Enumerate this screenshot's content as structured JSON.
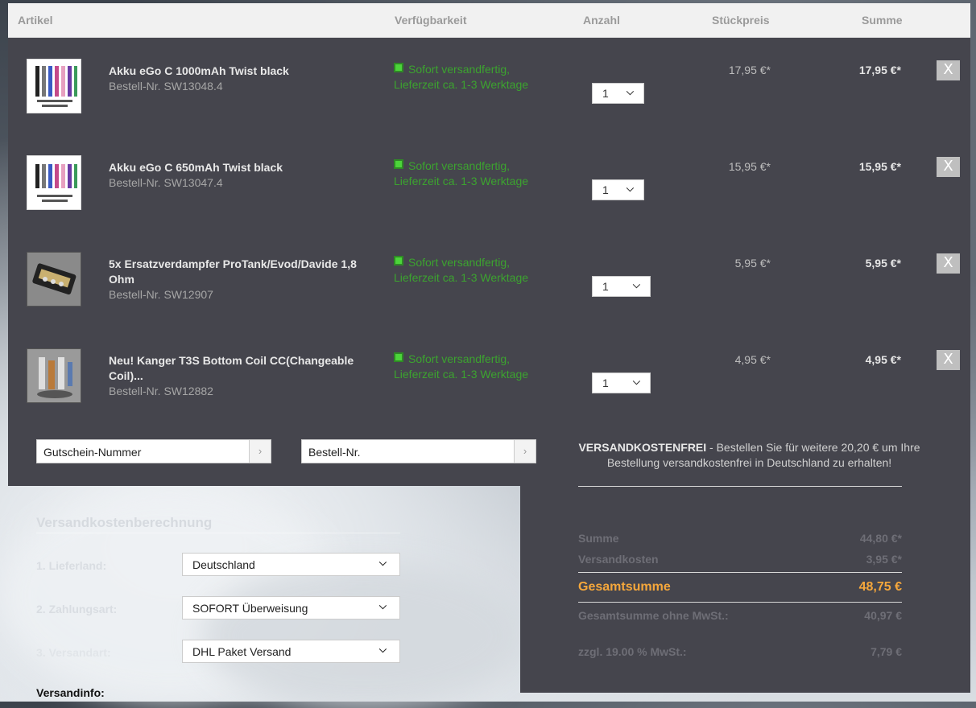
{
  "header": {
    "col_article": "Artikel",
    "col_availability": "Verfügbarkeit",
    "col_quantity": "Anzahl",
    "col_unit_price": "Stückpreis",
    "col_total": "Summe"
  },
  "items": [
    {
      "name": "Akku eGo C 1000mAh Twist black",
      "order_no": "Bestell-Nr. SW13048.4",
      "availability_line1": "Sofort versandfertig,",
      "availability_line2": "Lieferzeit ca. 1-3 Werktage",
      "quantity": "1",
      "unit_price": "17,95 €*",
      "total": "17,95 €*",
      "remove": "X"
    },
    {
      "name": "Akku eGo C 650mAh Twist black",
      "order_no": "Bestell-Nr. SW13047.4",
      "availability_line1": "Sofort versandfertig,",
      "availability_line2": "Lieferzeit ca. 1-3 Werktage",
      "quantity": "1",
      "unit_price": "15,95 €*",
      "total": "15,95 €*",
      "remove": "X"
    },
    {
      "name": "5x Ersatzverdampfer ProTank/Evod/Davide 1,8 Ohm",
      "order_no": "Bestell-Nr. SW12907",
      "availability_line1": "Sofort versandfertig,",
      "availability_line2": "Lieferzeit ca. 1-3 Werktage",
      "quantity": "1",
      "unit_price": "5,95 €*",
      "total": "5,95 €*",
      "remove": "X"
    },
    {
      "name": "Neu! Kanger T3S Bottom Coil CC(Changeable Coil)...",
      "order_no": "Bestell-Nr. SW12882",
      "availability_line1": "Sofort versandfertig,",
      "availability_line2": "Lieferzeit ca. 1-3 Werktage",
      "quantity": "1",
      "unit_price": "4,95 €*",
      "total": "4,95 €*",
      "remove": "X"
    }
  ],
  "voucher": {
    "value": "Gutschein-Nummer",
    "button": "›"
  },
  "order_number_input": {
    "value": "Bestell-Nr.",
    "button": "›"
  },
  "shipping_notice": {
    "bold": "VERSANDKOSTENFREI",
    "text": " - Bestellen Sie für weitere 20,20 € um Ihre Bestellung versandkostenfrei in Deutschland zu erhalten!"
  },
  "summary": {
    "subtotal_label": "Summe",
    "subtotal_value": "44,80 €*",
    "shipping_label": "Versandkosten",
    "shipping_value": "3,95 €*",
    "grand_label": "Gesamtsumme",
    "grand_value": "48,75 €",
    "net_label": "Gesamtsumme ohne MwSt.:",
    "net_value": "40,97 €",
    "vat_label": "zzgl. 19.00 % MwSt.:",
    "vat_value": "7,79 €"
  },
  "shipping_calc": {
    "title": "Versandkostenberechnung",
    "country_label": "1. Lieferland:",
    "country_value": "Deutschland",
    "payment_label": "2. Zahlungsart:",
    "payment_value": "SOFORT Überweisung",
    "method_label": "3. Versandart:",
    "method_value": "DHL Paket Versand",
    "info_label": "Versandinfo:"
  },
  "colors": {
    "panel": "#45454d",
    "availability": "#3ca32f",
    "grand_total": "#f5a73b"
  }
}
